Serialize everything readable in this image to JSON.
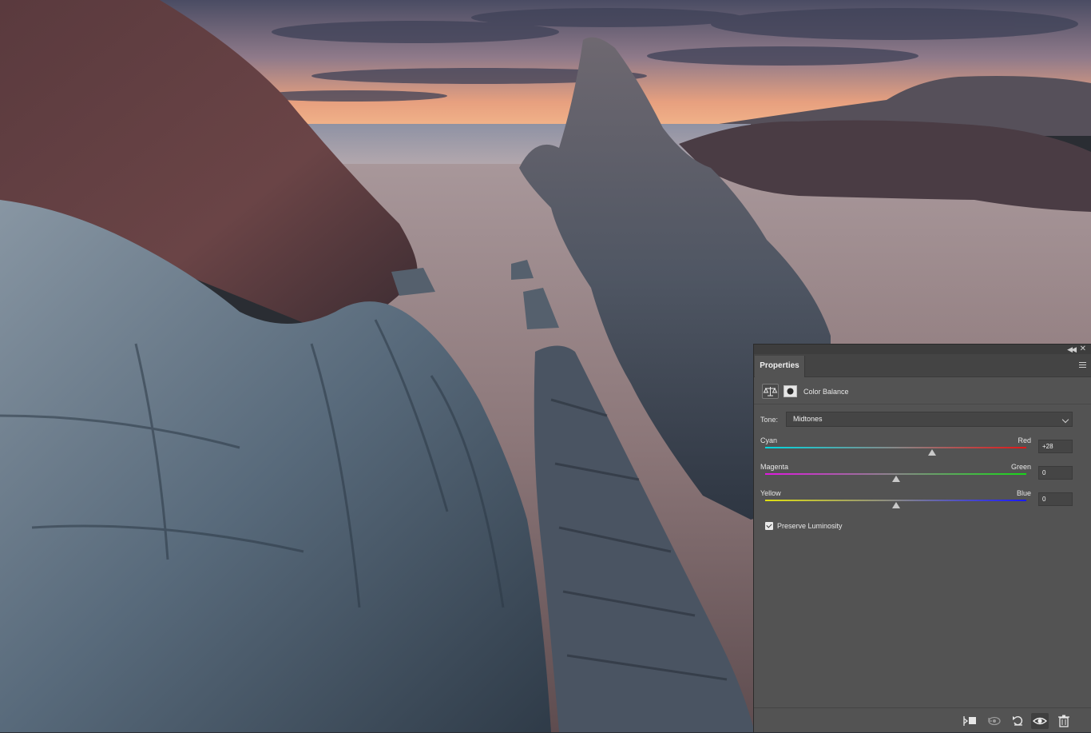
{
  "panel": {
    "tab_label": "Properties",
    "adjustment_title": "Color Balance",
    "tone_label": "Tone:",
    "tone_value": "Midtones",
    "sliders": [
      {
        "left_label": "Cyan",
        "right_label": "Red",
        "value": "+28",
        "numeric": 28,
        "left_color": "#00d8e0",
        "right_color": "#e01818"
      },
      {
        "left_label": "Magenta",
        "right_label": "Green",
        "value": "0",
        "numeric": 0,
        "left_color": "#e018e0",
        "right_color": "#18d818"
      },
      {
        "left_label": "Yellow",
        "right_label": "Blue",
        "value": "0",
        "numeric": 0,
        "left_color": "#e0e010",
        "right_color": "#1818ff"
      }
    ],
    "preserve_luminosity_label": "Preserve Luminosity",
    "preserve_luminosity_checked": true,
    "header_icons": [
      "collapse-icon",
      "close-icon",
      "panel-menu-icon"
    ],
    "bottom_icons": [
      "clip-to-layer-icon",
      "view-previous-state-icon",
      "reset-icon",
      "visibility-eye-icon",
      "trash-icon"
    ]
  }
}
